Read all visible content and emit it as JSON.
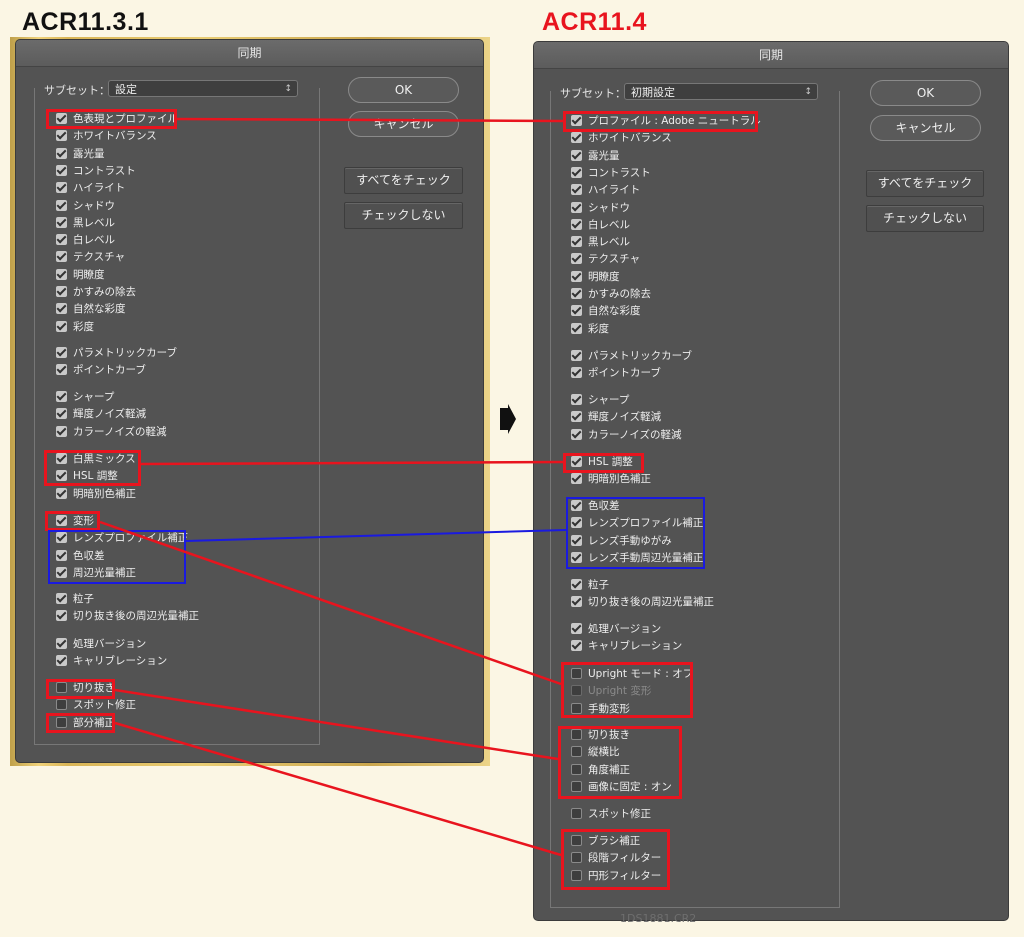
{
  "headings": {
    "left": "ACR11.3.1",
    "right": "ACR11.4"
  },
  "left_dialog": {
    "title": "同期",
    "subset_label": "サブセット：",
    "subset_value": "設定",
    "ok": "OK",
    "cancel": "キャンセル",
    "check_all": "すべてをチェック",
    "check_none": "チェックしない",
    "items": [
      {
        "label": "色表現とプロファイル",
        "checked": true
      },
      {
        "label": "ホワイトバランス",
        "checked": true
      },
      {
        "label": "露光量",
        "checked": true
      },
      {
        "label": "コントラスト",
        "checked": true
      },
      {
        "label": "ハイライト",
        "checked": true
      },
      {
        "label": "シャドウ",
        "checked": true
      },
      {
        "label": "黒レベル",
        "checked": true
      },
      {
        "label": "白レベル",
        "checked": true
      },
      {
        "label": "テクスチャ",
        "checked": true
      },
      {
        "label": "明瞭度",
        "checked": true
      },
      {
        "label": "かすみの除去",
        "checked": true
      },
      {
        "label": "自然な彩度",
        "checked": true
      },
      {
        "label": "彩度",
        "checked": true
      },
      {
        "label": "パラメトリックカーブ",
        "checked": true
      },
      {
        "label": "ポイントカーブ",
        "checked": true
      },
      {
        "label": "シャープ",
        "checked": true
      },
      {
        "label": "輝度ノイズ軽減",
        "checked": true
      },
      {
        "label": "カラーノイズの軽減",
        "checked": true
      },
      {
        "label": "白黒ミックス",
        "checked": true
      },
      {
        "label": "HSL 調整",
        "checked": true
      },
      {
        "label": "明暗別色補正",
        "checked": true
      },
      {
        "label": "変形",
        "checked": true
      },
      {
        "label": "レンズプロファイル補正",
        "checked": true
      },
      {
        "label": "色収差",
        "checked": true
      },
      {
        "label": "周辺光量補正",
        "checked": true
      },
      {
        "label": "粒子",
        "checked": true
      },
      {
        "label": "切り抜き後の周辺光量補正",
        "checked": true
      },
      {
        "label": "処理バージョン",
        "checked": true
      },
      {
        "label": "キャリブレーション",
        "checked": true
      },
      {
        "label": "切り抜き",
        "checked": false
      },
      {
        "label": "スポット修正",
        "checked": false
      },
      {
        "label": "部分補正",
        "checked": false
      }
    ]
  },
  "right_dialog": {
    "title": "同期",
    "subset_label": "サブセット：",
    "subset_value": "初期設定",
    "ok": "OK",
    "cancel": "キャンセル",
    "check_all": "すべてをチェック",
    "check_none": "チェックしない",
    "footer_text": "1DS1881.CR2",
    "items": [
      {
        "label": "プロファイル : Adobe ニュートラル",
        "checked": true
      },
      {
        "label": "ホワイトバランス",
        "checked": true
      },
      {
        "label": "露光量",
        "checked": true
      },
      {
        "label": "コントラスト",
        "checked": true
      },
      {
        "label": "ハイライト",
        "checked": true
      },
      {
        "label": "シャドウ",
        "checked": true
      },
      {
        "label": "白レベル",
        "checked": true
      },
      {
        "label": "黒レベル",
        "checked": true
      },
      {
        "label": "テクスチャ",
        "checked": true
      },
      {
        "label": "明瞭度",
        "checked": true
      },
      {
        "label": "かすみの除去",
        "checked": true
      },
      {
        "label": "自然な彩度",
        "checked": true
      },
      {
        "label": "彩度",
        "checked": true
      },
      {
        "label": "パラメトリックカーブ",
        "checked": true
      },
      {
        "label": "ポイントカーブ",
        "checked": true
      },
      {
        "label": "シャープ",
        "checked": true
      },
      {
        "label": "輝度ノイズ軽減",
        "checked": true
      },
      {
        "label": "カラーノイズの軽減",
        "checked": true
      },
      {
        "label": "HSL 調整",
        "checked": true
      },
      {
        "label": "明暗別色補正",
        "checked": true
      },
      {
        "label": "色収差",
        "checked": true
      },
      {
        "label": "レンズプロファイル補正",
        "checked": true
      },
      {
        "label": "レンズ手動ゆがみ",
        "checked": true
      },
      {
        "label": "レンズ手動周辺光量補正",
        "checked": true
      },
      {
        "label": "粒子",
        "checked": true
      },
      {
        "label": "切り抜き後の周辺光量補正",
        "checked": true
      },
      {
        "label": "処理バージョン",
        "checked": true
      },
      {
        "label": "キャリブレーション",
        "checked": true
      },
      {
        "label": "Upright モード : オフ",
        "checked": false
      },
      {
        "label": "Upright 変形",
        "checked": false,
        "disabled": true
      },
      {
        "label": "手動変形",
        "checked": false
      },
      {
        "label": "切り抜き",
        "checked": false
      },
      {
        "label": "縦横比",
        "checked": false
      },
      {
        "label": "角度補正",
        "checked": false
      },
      {
        "label": "画像に固定 : オン",
        "checked": false
      },
      {
        "label": "スポット修正",
        "checked": false
      },
      {
        "label": "ブラシ補正",
        "checked": false
      },
      {
        "label": "段階フィルター",
        "checked": false
      },
      {
        "label": "円形フィルター",
        "checked": false
      }
    ]
  },
  "colors": {
    "highlight_red": "#e8141e",
    "highlight_blue": "#1a1ae0",
    "heading_right": "#e8141e"
  }
}
